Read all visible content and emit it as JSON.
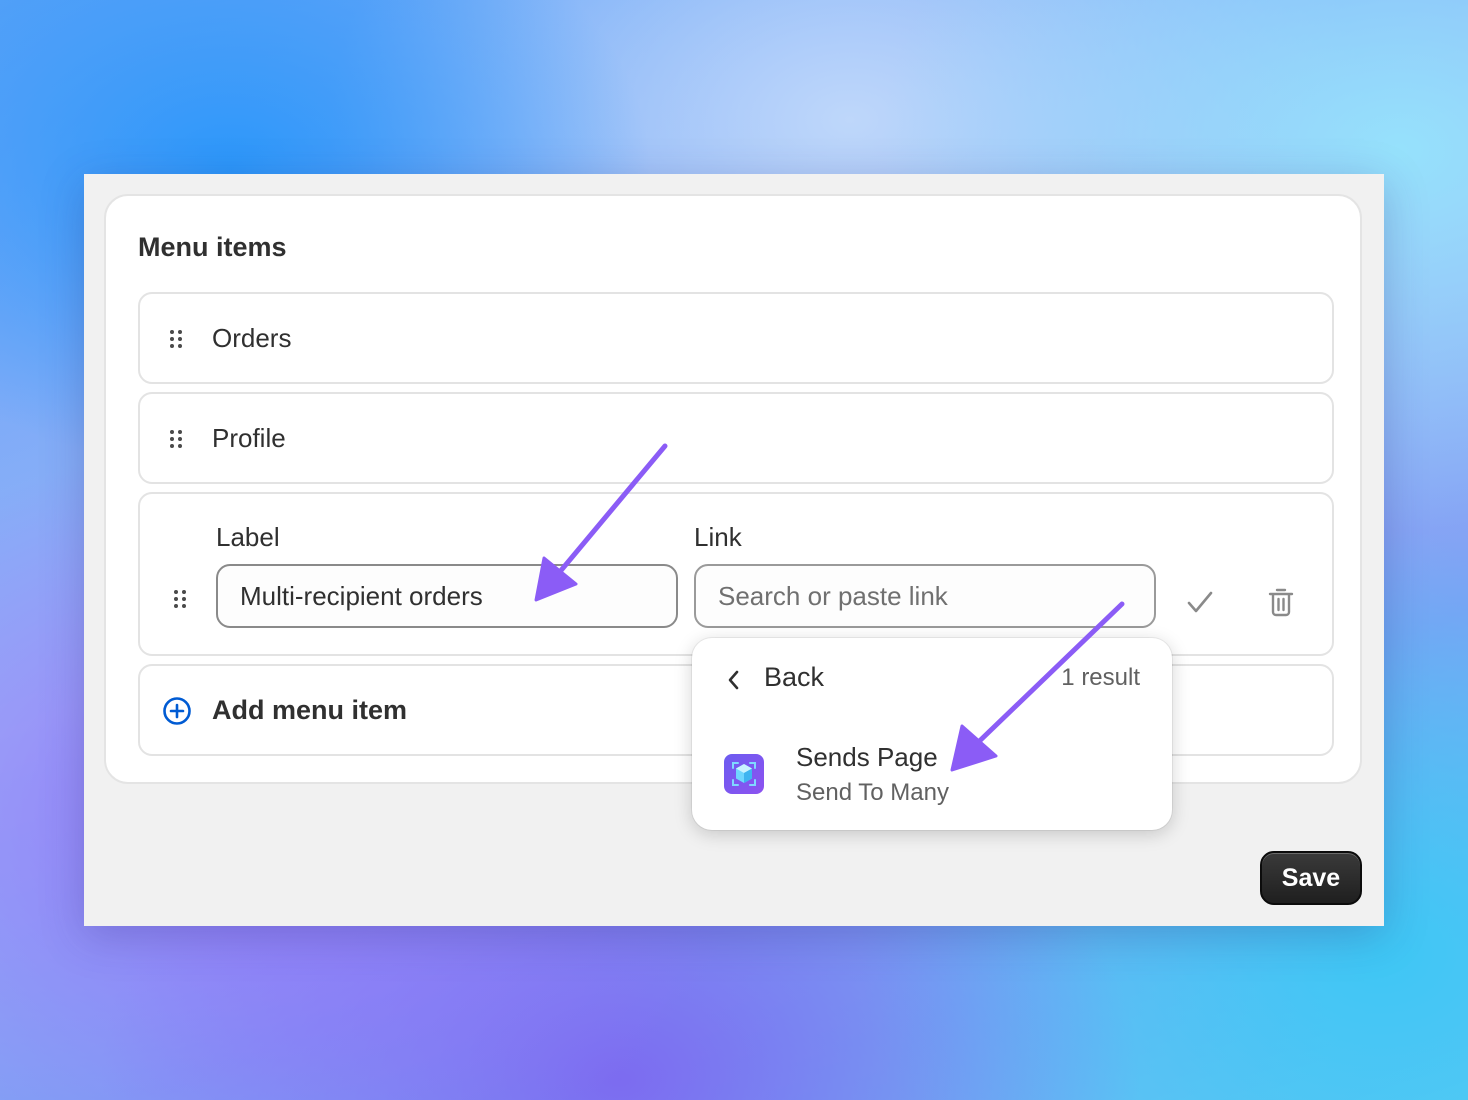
{
  "card": {
    "title": "Menu items"
  },
  "menu_items": [
    {
      "label": "Orders"
    },
    {
      "label": "Profile"
    }
  ],
  "edit_row": {
    "label_field_label": "Label",
    "label_value": "Multi-recipient orders",
    "link_field_label": "Link",
    "link_placeholder": "Search or paste link"
  },
  "add_item": {
    "label": "Add menu item"
  },
  "popover": {
    "back_label": "Back",
    "result_count": "1 result",
    "results": [
      {
        "title": "Sends Page",
        "subtitle": "Send To Many",
        "icon": "cube-app-icon"
      }
    ]
  },
  "footer": {
    "save_label": "Save"
  },
  "colors": {
    "accent_blue": "#005bd3",
    "arrow_purple": "#8b5cf6",
    "save_button": "#2a2a2a",
    "app_icon": "#7a58f0"
  }
}
